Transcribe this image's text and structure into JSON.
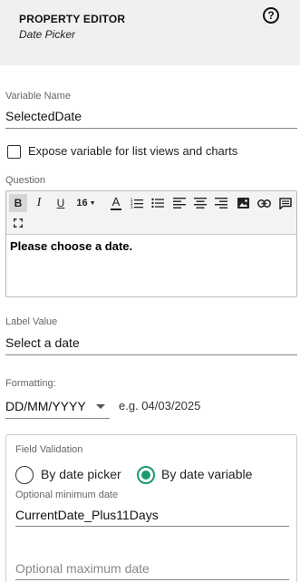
{
  "header": {
    "title": "PROPERTY EDITOR",
    "subtitle": "Date Picker",
    "help_icon": "question-circle-icon"
  },
  "variable_name": {
    "label": "Variable Name",
    "value": "SelectedDate"
  },
  "expose": {
    "label": "Expose variable for list views and charts",
    "checked": false
  },
  "question": {
    "label": "Question",
    "toolbar": {
      "bold": "B",
      "italic": "I",
      "underline": "U",
      "font_size": "16",
      "font_color": "A",
      "icons": [
        "bold-icon",
        "italic-icon",
        "underline-icon",
        "font-size-icon",
        "font-color-icon",
        "ordered-list-icon",
        "unordered-list-icon",
        "align-left-icon",
        "align-center-icon",
        "align-right-icon",
        "image-icon",
        "link-icon",
        "comment-icon",
        "fullscreen-icon"
      ]
    },
    "content": "Please choose a date."
  },
  "label_value": {
    "label": "Label Value",
    "value": "Select a date"
  },
  "formatting": {
    "label": "Formatting:",
    "selected": "DD/MM/YYYY",
    "example": "e.g. 04/03/2025"
  },
  "validation": {
    "title": "Field Validation",
    "option_picker": "By date picker",
    "option_variable": "By date variable",
    "selected_option": "By date variable",
    "min_label": "Optional minimum date",
    "min_value": "CurrentDate_Plus11Days",
    "max_placeholder": "Optional maximum date"
  },
  "colors": {
    "accent": "#1a9a6b",
    "header_bg": "#f0f0f0"
  }
}
